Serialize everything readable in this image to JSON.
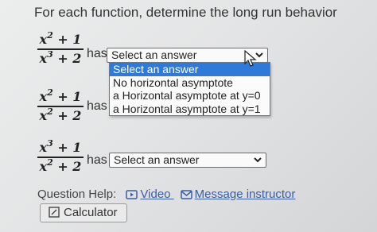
{
  "instructions": "For each function, determine the long run behavior",
  "problems": [
    {
      "numerator": "x",
      "num_exp": "2",
      "num_rest": " + 1",
      "denominator": "x",
      "den_exp": "3",
      "den_rest": " + 2",
      "has": "has",
      "selected": "Select an answer"
    },
    {
      "numerator": "x",
      "num_exp": "2",
      "num_rest": " + 1",
      "denominator": "x",
      "den_exp": "2",
      "den_rest": " + 2",
      "has": "has",
      "selected": "Select an answer"
    },
    {
      "numerator": "x",
      "num_exp": "3",
      "num_rest": " + 1",
      "denominator": "x",
      "den_exp": "2",
      "den_rest": " + 2",
      "has": "has",
      "selected": "Select an answer"
    }
  ],
  "dropdown_options": [
    "Select an answer",
    "No horizontal asymptote",
    "a Horizontal asymptote at y=0",
    "a Horizontal asymptote at y=1"
  ],
  "highlighted_option_index": 0,
  "help": {
    "label": "Question Help:",
    "video": "Video",
    "message": "Message instructor"
  },
  "calculator_label": "Calculator",
  "colors": {
    "highlight": "#2f7ad8",
    "link": "#3a5da8"
  },
  "icons": [
    "chevron-down-icon",
    "mouse-pointer-icon",
    "video-icon",
    "envelope-icon",
    "calculator-icon"
  ]
}
